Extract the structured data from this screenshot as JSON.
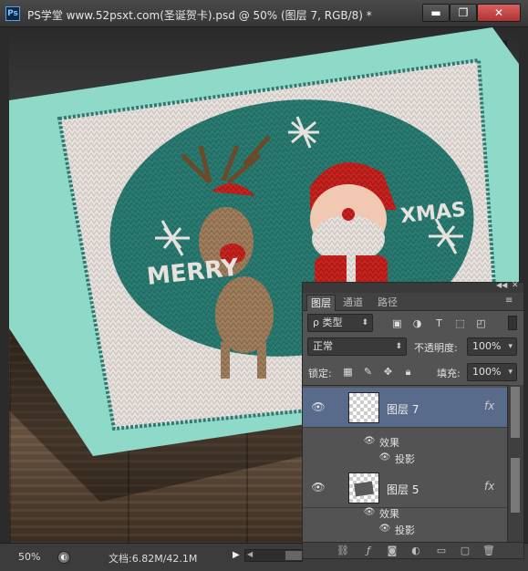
{
  "app": {
    "logo": "Ps",
    "title": "PS学堂 www.52psxt.com(圣诞贺卡).psd @ 50% (图层 7, RGB/8) *"
  },
  "window_controls": {
    "minimize": "▬",
    "maximize": "❐",
    "close": "✕"
  },
  "artwork": {
    "left_text": "MERRY",
    "right_text": "XMAS",
    "colors": {
      "card_mint": "#8fd9c9",
      "knit_white": "#e8e2de",
      "knit_teal": "#2a7c72",
      "santa_red": "#c8231e",
      "deer_brown": "#a07e5d"
    }
  },
  "status_bar": {
    "zoom": "50%",
    "doc_info": "文档:6.82M/42.1M",
    "menu_arrow": "▶"
  },
  "layers_panel": {
    "tabs": [
      {
        "label": "图层"
      },
      {
        "label": "通道"
      },
      {
        "label": "路径"
      }
    ],
    "filter": {
      "label": "ρ 类型"
    },
    "filter_icons": [
      "image-filter-icon",
      "adjustment-filter-icon",
      "type-filter-icon",
      "shape-filter-icon",
      "smart-object-filter-icon"
    ],
    "blend_mode": "正常",
    "opacity_label": "不透明度:",
    "opacity_value": "100%",
    "lock_label": "锁定:",
    "fill_label": "填充:",
    "fill_value": "100%",
    "layers": [
      {
        "name": "图层 7",
        "fx": "fx",
        "selected": true,
        "effects_label": "效果",
        "effect": "投影"
      },
      {
        "name": "图层 5",
        "fx": "fx",
        "selected": false,
        "effects_label": "效果",
        "effect": "投影"
      }
    ]
  }
}
